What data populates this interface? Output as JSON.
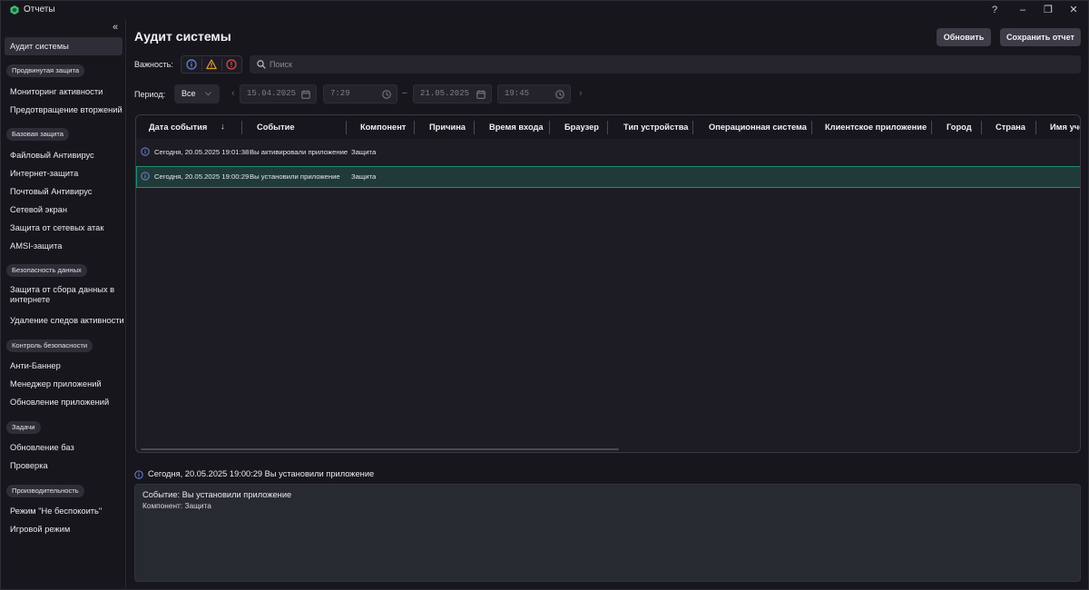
{
  "window": {
    "title": "Отчеты",
    "help_glyph": "?",
    "minimize_glyph": "–",
    "restore_glyph": "❐",
    "close_glyph": "✕"
  },
  "sidebar": {
    "collapse_glyph": "«",
    "active": "Аудит системы",
    "groups": {
      "advanced": "Продвинутая защита",
      "base": "Базовая защита",
      "data": "Безопасность данных",
      "control": "Контроль безопасности",
      "tasks": "Задачи",
      "perf": "Производительность"
    },
    "items": {
      "audit": "Аудит системы",
      "monitoring": "Мониторинг активности",
      "intrusion": "Предотвращение вторжений",
      "file_av": "Файловый Антивирус",
      "web": "Интернет-защита",
      "mail_av": "Почтовый Антивирус",
      "firewall": "Сетевой экран",
      "net_attacks": "Защита от сетевых атак",
      "amsi": "AMSI-защита",
      "data_collection": "Защита от сбора данных в интернете",
      "traces": "Удаление следов активности",
      "antibanner": "Анти-Баннер",
      "app_manager": "Менеджер приложений",
      "app_update": "Обновление приложений",
      "db_update": "Обновление баз",
      "scan": "Проверка",
      "dnd": "Режим \"Не беспокоить\"",
      "game": "Игровой режим"
    }
  },
  "header": {
    "title": "Аудит системы",
    "refresh": "Обновить",
    "save_report": "Сохранить отчет"
  },
  "filters": {
    "severity_label": "Важность:",
    "search_placeholder": "Поиск",
    "period_label": "Период:",
    "period_value": "Все",
    "from_date": "15.04.2025",
    "from_time": "7:29",
    "dash": "–",
    "to_date": "21.05.2025",
    "to_time": "19:45"
  },
  "colors": {
    "info": "#6b86d8",
    "warning": "#e0a02c",
    "error": "#e0474c",
    "selected_row": "#1f8d74",
    "app_icon": "#3fbf71"
  },
  "table": {
    "columns": [
      "Дата события",
      "Событие",
      "Компонент",
      "Причина",
      "Время входа",
      "Браузер",
      "Тип устройства",
      "Операционная система",
      "Клиентское приложение",
      "Город",
      "Страна",
      "Имя уче"
    ],
    "sort_glyph": "↓",
    "rows": [
      {
        "date": "Сегодня, 20.05.2025 19:01:38",
        "event": "Вы активировали приложение",
        "component": "Защита",
        "severity_icon": "info-icon"
      },
      {
        "date": "Сегодня, 20.05.2025 19:00:29",
        "event": "Вы установили приложение",
        "component": "Защита",
        "severity_icon": "info-icon"
      }
    ]
  },
  "detail": {
    "heading": "Сегодня, 20.05.2025 19:00:29 Вы установили приложение",
    "event_line": "Событие: Вы установили приложение",
    "component_line": "Компонент: Защита"
  }
}
